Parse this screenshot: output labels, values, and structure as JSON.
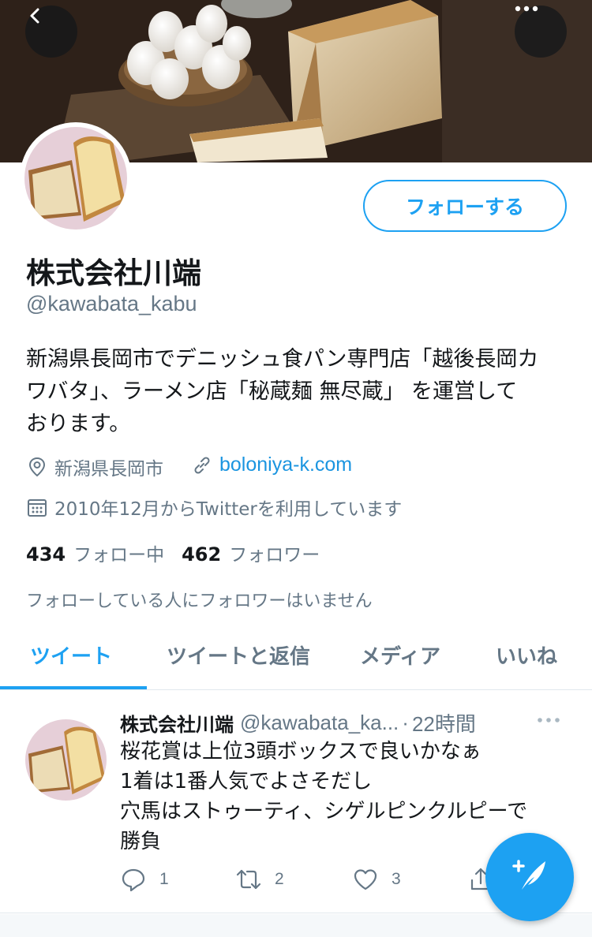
{
  "header": {
    "back_icon": "chevron-left-icon",
    "more_icon": "more-horizontal-icon"
  },
  "profile": {
    "display_name": "株式会社川端",
    "handle": "@kawabata_kabu",
    "follow_button_label": "フォローする",
    "bio_lines": [
      "新潟県長岡市でデニッシュ食パン専門店「越後長岡カ",
      "ワバタ」、ラーメン店「秘蔵麺 無尽蔵」 を運営して",
      "おります。"
    ],
    "location": "新潟県長岡市",
    "website": "boloniya-k.com",
    "joined": "2010年12月からTwitterを利用しています",
    "following_count": "434",
    "following_label": "フォロー中",
    "followers_count": "462",
    "followers_label": "フォロワー",
    "followers_you_know": "フォローしている人にフォロワーはいません"
  },
  "tabs": [
    {
      "label": "ツイート",
      "active": true
    },
    {
      "label": "ツイートと返信",
      "active": false
    },
    {
      "label": "メディア",
      "active": false
    },
    {
      "label": "いいね",
      "active": false
    }
  ],
  "tweet": {
    "author_name": "株式会社川端",
    "author_handle": "@kawabata_ka...",
    "separator": "·",
    "time": "22時間",
    "body_lines": [
      "桜花賞は上位3頭ボックスで良いかなぁ",
      "1着は1番人気でよさそだし",
      "穴馬はストゥーティ、シゲルピンクルピーで",
      "勝負"
    ],
    "reply_count": "1",
    "retweet_count": "2",
    "like_count": "3"
  },
  "colors": {
    "accent": "#1da1f2",
    "link": "#1b95e0",
    "text_primary": "#14171a",
    "text_secondary": "#657786",
    "divider": "#e1e8ed"
  },
  "fab": {
    "icon": "compose-tweet-icon"
  }
}
